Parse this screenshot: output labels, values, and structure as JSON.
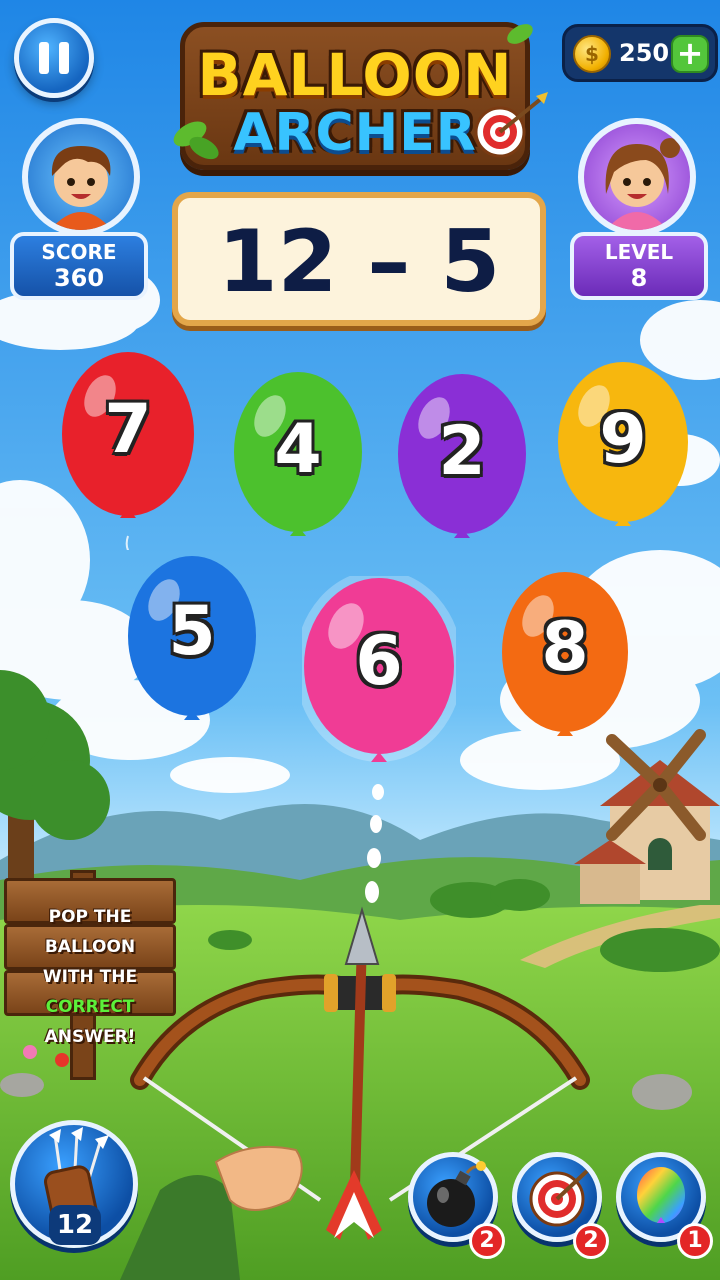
{
  "title": {
    "line1": "BALLOON",
    "line2": "ARCHER"
  },
  "coins": {
    "count": "250",
    "add_label": "+"
  },
  "player": {
    "score_label": "SCORE",
    "score_value": "360"
  },
  "level": {
    "label": "LEVEL",
    "value": "8"
  },
  "equation": "12 – 5",
  "balloons": [
    {
      "number": "7",
      "color": "#e8212b"
    },
    {
      "number": "4",
      "color": "#4cc12d"
    },
    {
      "number": "2",
      "color": "#8a2fd6"
    },
    {
      "number": "9",
      "color": "#f7b70e"
    },
    {
      "number": "5",
      "color": "#1c74e0"
    },
    {
      "number": "6",
      "color": "#f03c95"
    },
    {
      "number": "8",
      "color": "#f36a12"
    }
  ],
  "sign": {
    "line1": "POP THE BALLOON",
    "line2": "WITH THE",
    "highlight": "CORRECT",
    "line4": "ANSWER!"
  },
  "quiver": {
    "arrows_left": "12"
  },
  "powerups": [
    {
      "name": "bomb",
      "count": "2"
    },
    {
      "name": "target",
      "count": "2"
    },
    {
      "name": "rainbow-balloon",
      "count": "1"
    }
  ],
  "colors": {
    "sky_top": "#2a8fe8",
    "grass": "#6fc23a",
    "accent_blue": "#1565c0"
  }
}
